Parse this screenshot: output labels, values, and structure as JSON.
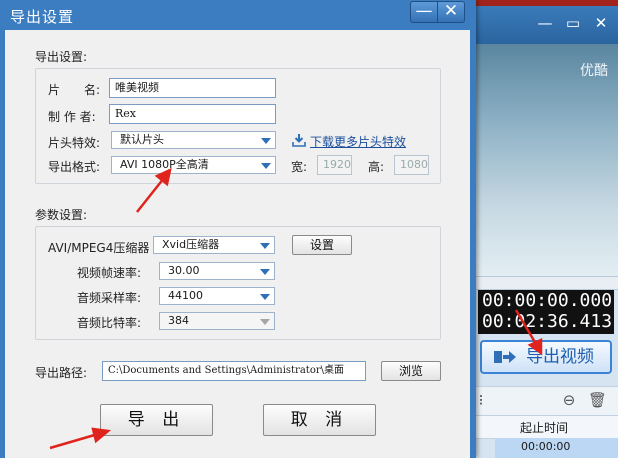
{
  "background_app": {
    "window_controls": [
      "—",
      "▭",
      "✕"
    ],
    "watermark": "优酷",
    "timecodes": [
      "00:00:00.000",
      "00:02:36.413"
    ],
    "export_button_label": "导出视频",
    "column_header": "起止时间",
    "row_time": "00:00:00"
  },
  "dialog": {
    "title": "导出设置",
    "minimize": "—",
    "close": "✕",
    "export_section": {
      "heading": "导出设置:",
      "name_label": "片　　名:",
      "name_value": "唯美视频",
      "author_label": "制 作 者:",
      "author_value": "Rex",
      "intro_label": "片头特效:",
      "intro_value": "默认片头",
      "download_link": "下载更多片头特效",
      "format_label": "导出格式:",
      "format_value": "AVI 1080P全高清",
      "width_label": "宽:",
      "width_value": "1920",
      "height_label": "高:",
      "height_value": "1080"
    },
    "param_section": {
      "heading": "参数设置:",
      "codec_label": "AVI/MPEG4压缩器",
      "codec_value": "Xvid压缩器",
      "settings_button": "设置",
      "fps_label": "视频帧速率:",
      "fps_value": "30.00",
      "sample_label": "音频采样率:",
      "sample_value": "44100",
      "bitrate_label": "音频比特率:",
      "bitrate_value": "384"
    },
    "path": {
      "label": "导出路径:",
      "value": "C:\\Documents and Settings\\Administrator\\桌面",
      "browse_button": "浏览"
    },
    "export_button": "导 出",
    "cancel_button": "取 消"
  },
  "colors": {
    "title_bar": "#3c7cc0",
    "annotation_arrow": "#e0231c",
    "accent_blue": "#3b83d6"
  }
}
